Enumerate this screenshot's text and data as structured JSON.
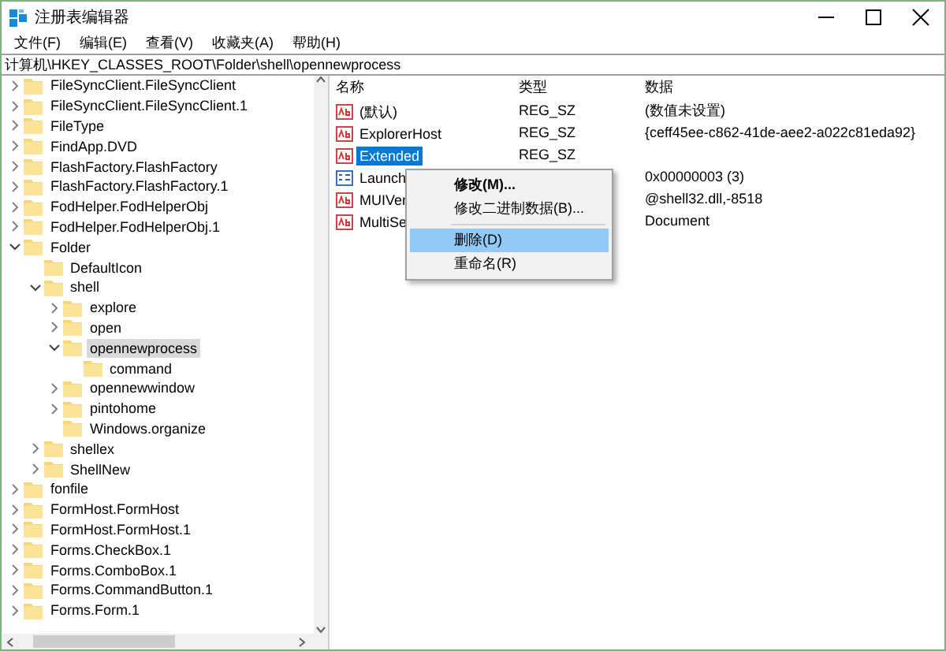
{
  "window": {
    "title": "注册表编辑器"
  },
  "menu": [
    "文件(F)",
    "编辑(E)",
    "查看(V)",
    "收藏夹(A)",
    "帮助(H)"
  ],
  "address": "计算机\\HKEY_CLASSES_ROOT\\Folder\\shell\\opennewprocess",
  "tree": [
    {
      "label": "FileSyncClient.FileSyncClient",
      "kind": "key",
      "expanded": false,
      "selected": false
    },
    {
      "label": "FileSyncClient.FileSyncClient.1",
      "kind": "key",
      "expanded": false,
      "selected": false
    },
    {
      "label": "FileType",
      "kind": "key",
      "expanded": false,
      "selected": false
    },
    {
      "label": "FindApp.DVD",
      "kind": "key",
      "expanded": false,
      "selected": false
    },
    {
      "label": "FlashFactory.FlashFactory",
      "kind": "key",
      "expanded": false,
      "selected": false
    },
    {
      "label": "FlashFactory.FlashFactory.1",
      "kind": "key",
      "expanded": false,
      "selected": false
    },
    {
      "label": "FodHelper.FodHelperObj",
      "kind": "key",
      "expanded": false,
      "selected": false
    },
    {
      "label": "FodHelper.FodHelperObj.1",
      "kind": "key",
      "expanded": false,
      "selected": false
    },
    {
      "label": "Folder",
      "kind": "key",
      "expanded": true,
      "selected": false,
      "children": [
        {
          "label": "DefaultIcon",
          "kind": "leaf",
          "selected": false
        },
        {
          "label": "shell",
          "kind": "key",
          "expanded": true,
          "selected": false,
          "children": [
            {
              "label": "explore",
              "kind": "key",
              "expanded": false,
              "selected": false
            },
            {
              "label": "open",
              "kind": "key",
              "expanded": false,
              "selected": false
            },
            {
              "label": "opennewprocess",
              "kind": "key",
              "expanded": true,
              "selected": true,
              "children": [
                {
                  "label": "command",
                  "kind": "leaf",
                  "selected": false
                }
              ]
            },
            {
              "label": "opennewwindow",
              "kind": "key",
              "expanded": false,
              "selected": false
            },
            {
              "label": "pintohome",
              "kind": "key",
              "expanded": false,
              "selected": false
            },
            {
              "label": "Windows.organize",
              "kind": "leaf",
              "selected": false
            }
          ]
        },
        {
          "label": "shellex",
          "kind": "key",
          "expanded": false,
          "selected": false
        },
        {
          "label": "ShellNew",
          "kind": "key",
          "expanded": false,
          "selected": false
        }
      ]
    },
    {
      "label": "fonfile",
      "kind": "key",
      "expanded": false,
      "selected": false
    },
    {
      "label": "FormHost.FormHost",
      "kind": "key",
      "expanded": false,
      "selected": false
    },
    {
      "label": "FormHost.FormHost.1",
      "kind": "key",
      "expanded": false,
      "selected": false
    },
    {
      "label": "Forms.CheckBox.1",
      "kind": "key",
      "expanded": false,
      "selected": false
    },
    {
      "label": "Forms.ComboBox.1",
      "kind": "key",
      "expanded": false,
      "selected": false
    },
    {
      "label": "Forms.CommandButton.1",
      "kind": "key",
      "expanded": false,
      "selected": false
    },
    {
      "label": "Forms.Form.1",
      "kind": "key",
      "expanded": false,
      "selected": false
    }
  ],
  "values": {
    "columns": [
      "名称",
      "类型",
      "数据"
    ],
    "rows": [
      {
        "kind": "string",
        "name": "(默认)",
        "type": "REG_SZ",
        "data": "(数值未设置)",
        "selected": false
      },
      {
        "kind": "string",
        "name": "ExplorerHost",
        "type": "REG_SZ",
        "data": "{ceff45ee-c862-41de-aee2-a022c81eda92}",
        "selected": false
      },
      {
        "kind": "string",
        "name": "Extended",
        "type": "REG_SZ",
        "selected": true
      },
      {
        "kind": "binary",
        "name": "Launch",
        "data": "0x00000003 (3)",
        "selected": false
      },
      {
        "kind": "string",
        "name": "MUIVer",
        "data": "@shell32.dll,-8518",
        "selected": false
      },
      {
        "kind": "string",
        "name": "MultiSe",
        "data": "Document",
        "selected": false
      }
    ]
  },
  "context_menu": [
    {
      "label": "修改(M)...",
      "default": true,
      "selected": false
    },
    {
      "label": "修改二进制数据(B)...",
      "default": false,
      "selected": false,
      "separator_after": true
    },
    {
      "label": "删除(D)",
      "default": false,
      "selected": true
    },
    {
      "label": "重命名(R)",
      "default": false,
      "selected": false
    }
  ]
}
